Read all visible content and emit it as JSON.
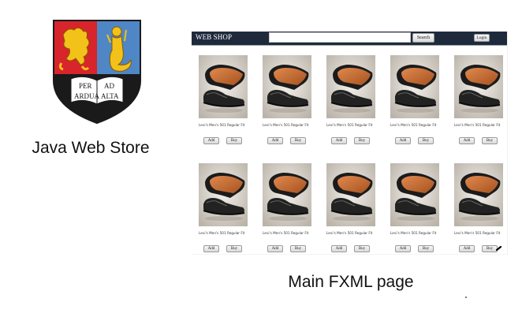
{
  "crest": {
    "scroll_left": "PER",
    "scroll_left2": "ARDUA",
    "scroll_right": "AD",
    "scroll_right2": "ALTA"
  },
  "captions": {
    "left": "Java Web Store",
    "right": "Main FXML page"
  },
  "app": {
    "brand": "WEB SHOP",
    "search": {
      "value": "",
      "placeholder": "",
      "button_label": "Search"
    },
    "login_label": "Login",
    "products": [
      {
        "title": "Levi's Men's 501 Regular Fit",
        "add_label": "Add",
        "buy_label": "Buy"
      },
      {
        "title": "Levi's Men's 501 Regular Fit",
        "add_label": "Add",
        "buy_label": "Buy"
      },
      {
        "title": "Levi's Men's 501 Regular Fit",
        "add_label": "Add",
        "buy_label": "Buy"
      },
      {
        "title": "Levi's Men's 501 Regular Fit",
        "add_label": "Add",
        "buy_label": "Buy"
      },
      {
        "title": "Levi's Men's 501 Regular Fit",
        "add_label": "Add",
        "buy_label": "Buy"
      },
      {
        "title": "Levi's Men's 501 Regular Fit",
        "add_label": "Add",
        "buy_label": "Buy"
      },
      {
        "title": "Levi's Men's 501 Regular Fit",
        "add_label": "Add",
        "buy_label": "Buy"
      },
      {
        "title": "Levi's Men's 501 Regular Fit",
        "add_label": "Add",
        "buy_label": "Buy"
      },
      {
        "title": "Levi's Men's 501 Regular Fit",
        "add_label": "Add",
        "buy_label": "Buy"
      },
      {
        "title": "Levi's Men's 501 Regular Fit",
        "add_label": "Add",
        "buy_label": "Buy"
      }
    ]
  },
  "colors": {
    "topbar": "#1e2a3c",
    "crest_red": "#d8242b",
    "crest_blue": "#4f86c6",
    "crest_gold": "#f2c21a",
    "crest_black": "#1a1a1a"
  }
}
